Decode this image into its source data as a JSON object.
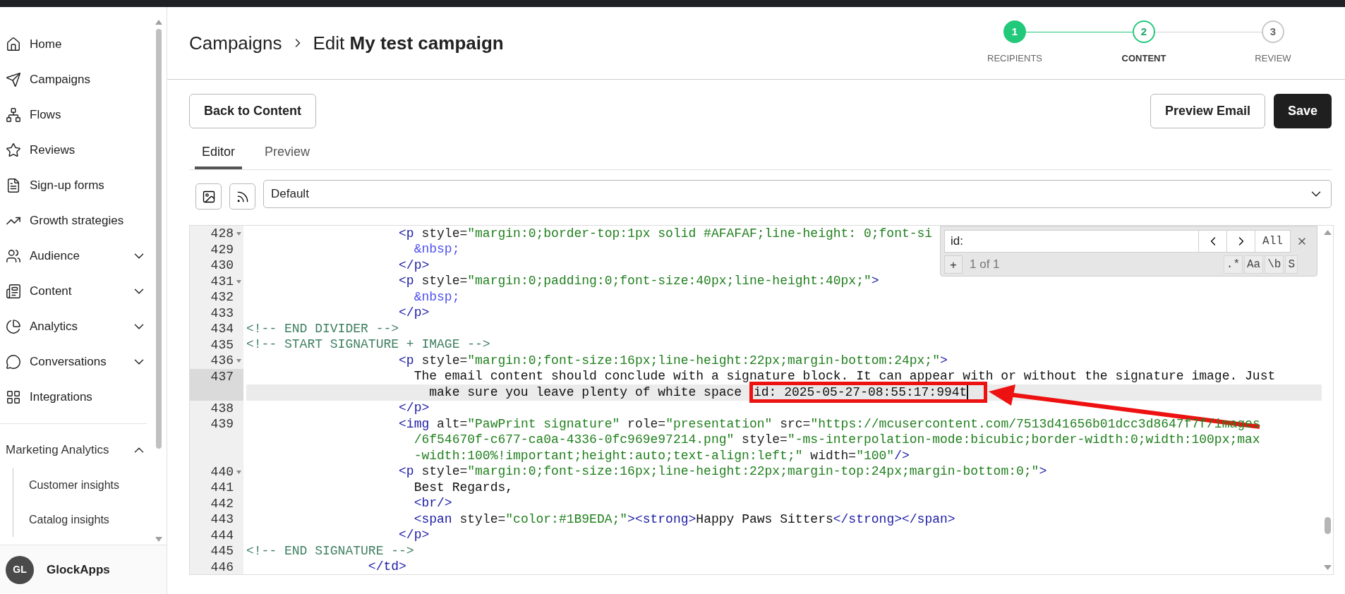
{
  "sidebar": {
    "items": [
      {
        "label": "Home",
        "kind": "link"
      },
      {
        "label": "Campaigns",
        "kind": "link"
      },
      {
        "label": "Flows",
        "kind": "link"
      },
      {
        "label": "Reviews",
        "kind": "link"
      },
      {
        "label": "Sign-up forms",
        "kind": "link"
      },
      {
        "label": "Growth strategies",
        "kind": "link"
      },
      {
        "label": "Audience",
        "kind": "group",
        "expanded": false
      },
      {
        "label": "Content",
        "kind": "group",
        "expanded": false
      },
      {
        "label": "Analytics",
        "kind": "group",
        "expanded": false
      },
      {
        "label": "Conversations",
        "kind": "group",
        "expanded": false
      },
      {
        "label": "Integrations",
        "kind": "link"
      }
    ],
    "section": {
      "label": "Marketing Analytics",
      "expanded": true,
      "children": [
        {
          "label": "Customer insights"
        },
        {
          "label": "Catalog insights"
        }
      ]
    },
    "account": {
      "initials": "GL",
      "name": "GlockApps"
    }
  },
  "header": {
    "breadcrumb": {
      "parent": "Campaigns",
      "current": "Edit **My test campaign**"
    },
    "steps": [
      {
        "number": "1",
        "label": "RECIPIENTS",
        "completed": true,
        "selected": false
      },
      {
        "number": "2",
        "label": "CONTENT",
        "completed": false,
        "selected": true
      },
      {
        "number": "3",
        "label": "REVIEW",
        "completed": false,
        "selected": false
      }
    ]
  },
  "actions": {
    "back": "Back to Content",
    "preview": "Preview Email",
    "save": "Save"
  },
  "editor_tabs": [
    {
      "label": "Editor",
      "selected": true
    },
    {
      "label": "Preview",
      "selected": false
    }
  ],
  "toolbar": {
    "template_select": {
      "value": "Default"
    }
  },
  "code_editor": {
    "lines": [
      {
        "number": "428",
        "fold": true,
        "active": false,
        "rows": [
          {
            "tokens": [
              {
                "kind": "tag",
                "text": "                    <p"
              },
              {
                "kind": "attr",
                "text": " style="
              },
              {
                "kind": "string",
                "text": "\"margin:0;border-top:1px solid #AFAFAF;line-height: 0;font-si"
              }
            ]
          }
        ]
      },
      {
        "number": "429",
        "fold": false,
        "active": false,
        "rows": [
          {
            "tokens": [
              {
                "kind": "entity",
                "text": "                      &nbsp;"
              }
            ]
          }
        ]
      },
      {
        "number": "430",
        "fold": false,
        "active": false,
        "rows": [
          {
            "tokens": [
              {
                "kind": "tag",
                "text": "                    </p>"
              }
            ]
          }
        ]
      },
      {
        "number": "431",
        "fold": true,
        "active": false,
        "rows": [
          {
            "tokens": [
              {
                "kind": "tag",
                "text": "                    <p"
              },
              {
                "kind": "attr",
                "text": " style="
              },
              {
                "kind": "string",
                "text": "\"margin:0;padding:0;font-size:40px;line-height:40px;\""
              },
              {
                "kind": "tag",
                "text": ">"
              }
            ]
          }
        ]
      },
      {
        "number": "432",
        "fold": false,
        "active": false,
        "rows": [
          {
            "tokens": [
              {
                "kind": "entity",
                "text": "                      &nbsp;"
              }
            ]
          }
        ]
      },
      {
        "number": "433",
        "fold": false,
        "active": false,
        "rows": [
          {
            "tokens": [
              {
                "kind": "tag",
                "text": "                    </p>"
              }
            ]
          }
        ]
      },
      {
        "number": "434",
        "fold": false,
        "active": false,
        "rows": [
          {
            "tokens": [
              {
                "kind": "comment",
                "text": "<!-- END DIVIDER -->"
              }
            ]
          }
        ]
      },
      {
        "number": "435",
        "fold": false,
        "active": false,
        "rows": [
          {
            "tokens": [
              {
                "kind": "comment",
                "text": "<!-- START SIGNATURE + IMAGE -->"
              }
            ]
          }
        ]
      },
      {
        "number": "436",
        "fold": true,
        "active": false,
        "rows": [
          {
            "tokens": [
              {
                "kind": "tag",
                "text": "                    <p"
              },
              {
                "kind": "attr",
                "text": " style="
              },
              {
                "kind": "string",
                "text": "\"margin:0;font-size:16px;line-height:22px;margin-bottom:24px;\""
              },
              {
                "kind": "tag",
                "text": ">"
              }
            ]
          }
        ]
      },
      {
        "number": "437",
        "fold": false,
        "active": true,
        "rows": [
          {
            "tokens": [
              {
                "kind": "text",
                "text": "                      The email content should conclude with a signature block. It can appear with or without the signature image. Just"
              }
            ]
          },
          {
            "tokens": [
              {
                "kind": "text",
                "text": "                        make sure you leave plenty of white space "
              },
              {
                "kind": "match",
                "text": "id: 2025-05-27-08:55:17:994t"
              }
            ]
          }
        ]
      },
      {
        "number": "438",
        "fold": false,
        "active": false,
        "rows": [
          {
            "tokens": [
              {
                "kind": "tag",
                "text": "                    </p>"
              }
            ]
          }
        ]
      },
      {
        "number": "439",
        "fold": false,
        "active": false,
        "rows": [
          {
            "tokens": [
              {
                "kind": "tag",
                "text": "                    <img"
              },
              {
                "kind": "attr",
                "text": " alt="
              },
              {
                "kind": "string",
                "text": "\"PawPrint signature\""
              },
              {
                "kind": "attr",
                "text": " role="
              },
              {
                "kind": "string",
                "text": "\"presentation\""
              },
              {
                "kind": "attr",
                "text": " src="
              },
              {
                "kind": "string",
                "text": "\"https://mcusercontent.com/7513d41656b01dcc3d8647f7f/images"
              }
            ]
          },
          {
            "tokens": [
              {
                "kind": "string",
                "text": "                      /6f54670f-c677-ca0a-4336-0fc969e97214.png\""
              },
              {
                "kind": "attr",
                "text": " style="
              },
              {
                "kind": "string",
                "text": "\"-ms-interpolation-mode:bicubic;border-width:0;width:100px;max"
              }
            ]
          },
          {
            "tokens": [
              {
                "kind": "string",
                "text": "                      -width:100%!important;height:auto;text-align:left;\""
              },
              {
                "kind": "attr",
                "text": " width="
              },
              {
                "kind": "string",
                "text": "\"100\""
              },
              {
                "kind": "tag",
                "text": "/>"
              }
            ]
          }
        ]
      },
      {
        "number": "440",
        "fold": true,
        "active": false,
        "rows": [
          {
            "tokens": [
              {
                "kind": "tag",
                "text": "                    <p"
              },
              {
                "kind": "attr",
                "text": " style="
              },
              {
                "kind": "string",
                "text": "\"margin:0;font-size:16px;line-height:22px;margin-top:24px;margin-bottom:0;\""
              },
              {
                "kind": "tag",
                "text": ">"
              }
            ]
          }
        ]
      },
      {
        "number": "441",
        "fold": false,
        "active": false,
        "rows": [
          {
            "tokens": [
              {
                "kind": "text",
                "text": "                      Best Regards,"
              }
            ]
          }
        ]
      },
      {
        "number": "442",
        "fold": false,
        "active": false,
        "rows": [
          {
            "tokens": [
              {
                "kind": "tag",
                "text": "                      <br/>"
              }
            ]
          }
        ]
      },
      {
        "number": "443",
        "fold": false,
        "active": false,
        "rows": [
          {
            "tokens": [
              {
                "kind": "tag",
                "text": "                      <span"
              },
              {
                "kind": "attr",
                "text": " style="
              },
              {
                "kind": "string",
                "text": "\"color:#1B9EDA;\""
              },
              {
                "kind": "tag",
                "text": "><strong>"
              },
              {
                "kind": "text",
                "text": "Happy Paws Sitters"
              },
              {
                "kind": "tag",
                "text": "</strong></span>"
              }
            ]
          }
        ]
      },
      {
        "number": "444",
        "fold": false,
        "active": false,
        "rows": [
          {
            "tokens": [
              {
                "kind": "tag",
                "text": "                    </p>"
              }
            ]
          }
        ]
      },
      {
        "number": "445",
        "fold": false,
        "active": false,
        "rows": [
          {
            "tokens": [
              {
                "kind": "comment",
                "text": "<!-- END SIGNATURE -->"
              }
            ]
          }
        ]
      },
      {
        "number": "446",
        "fold": false,
        "active": false,
        "rows": [
          {
            "tokens": [
              {
                "kind": "tag",
                "text": "                </td>"
              }
            ]
          }
        ]
      }
    ],
    "search": {
      "query": "id:",
      "all": "All",
      "add": "+",
      "count": "1 of 1",
      "options": [
        ".*",
        "Aa",
        "\\b",
        "S"
      ]
    }
  }
}
